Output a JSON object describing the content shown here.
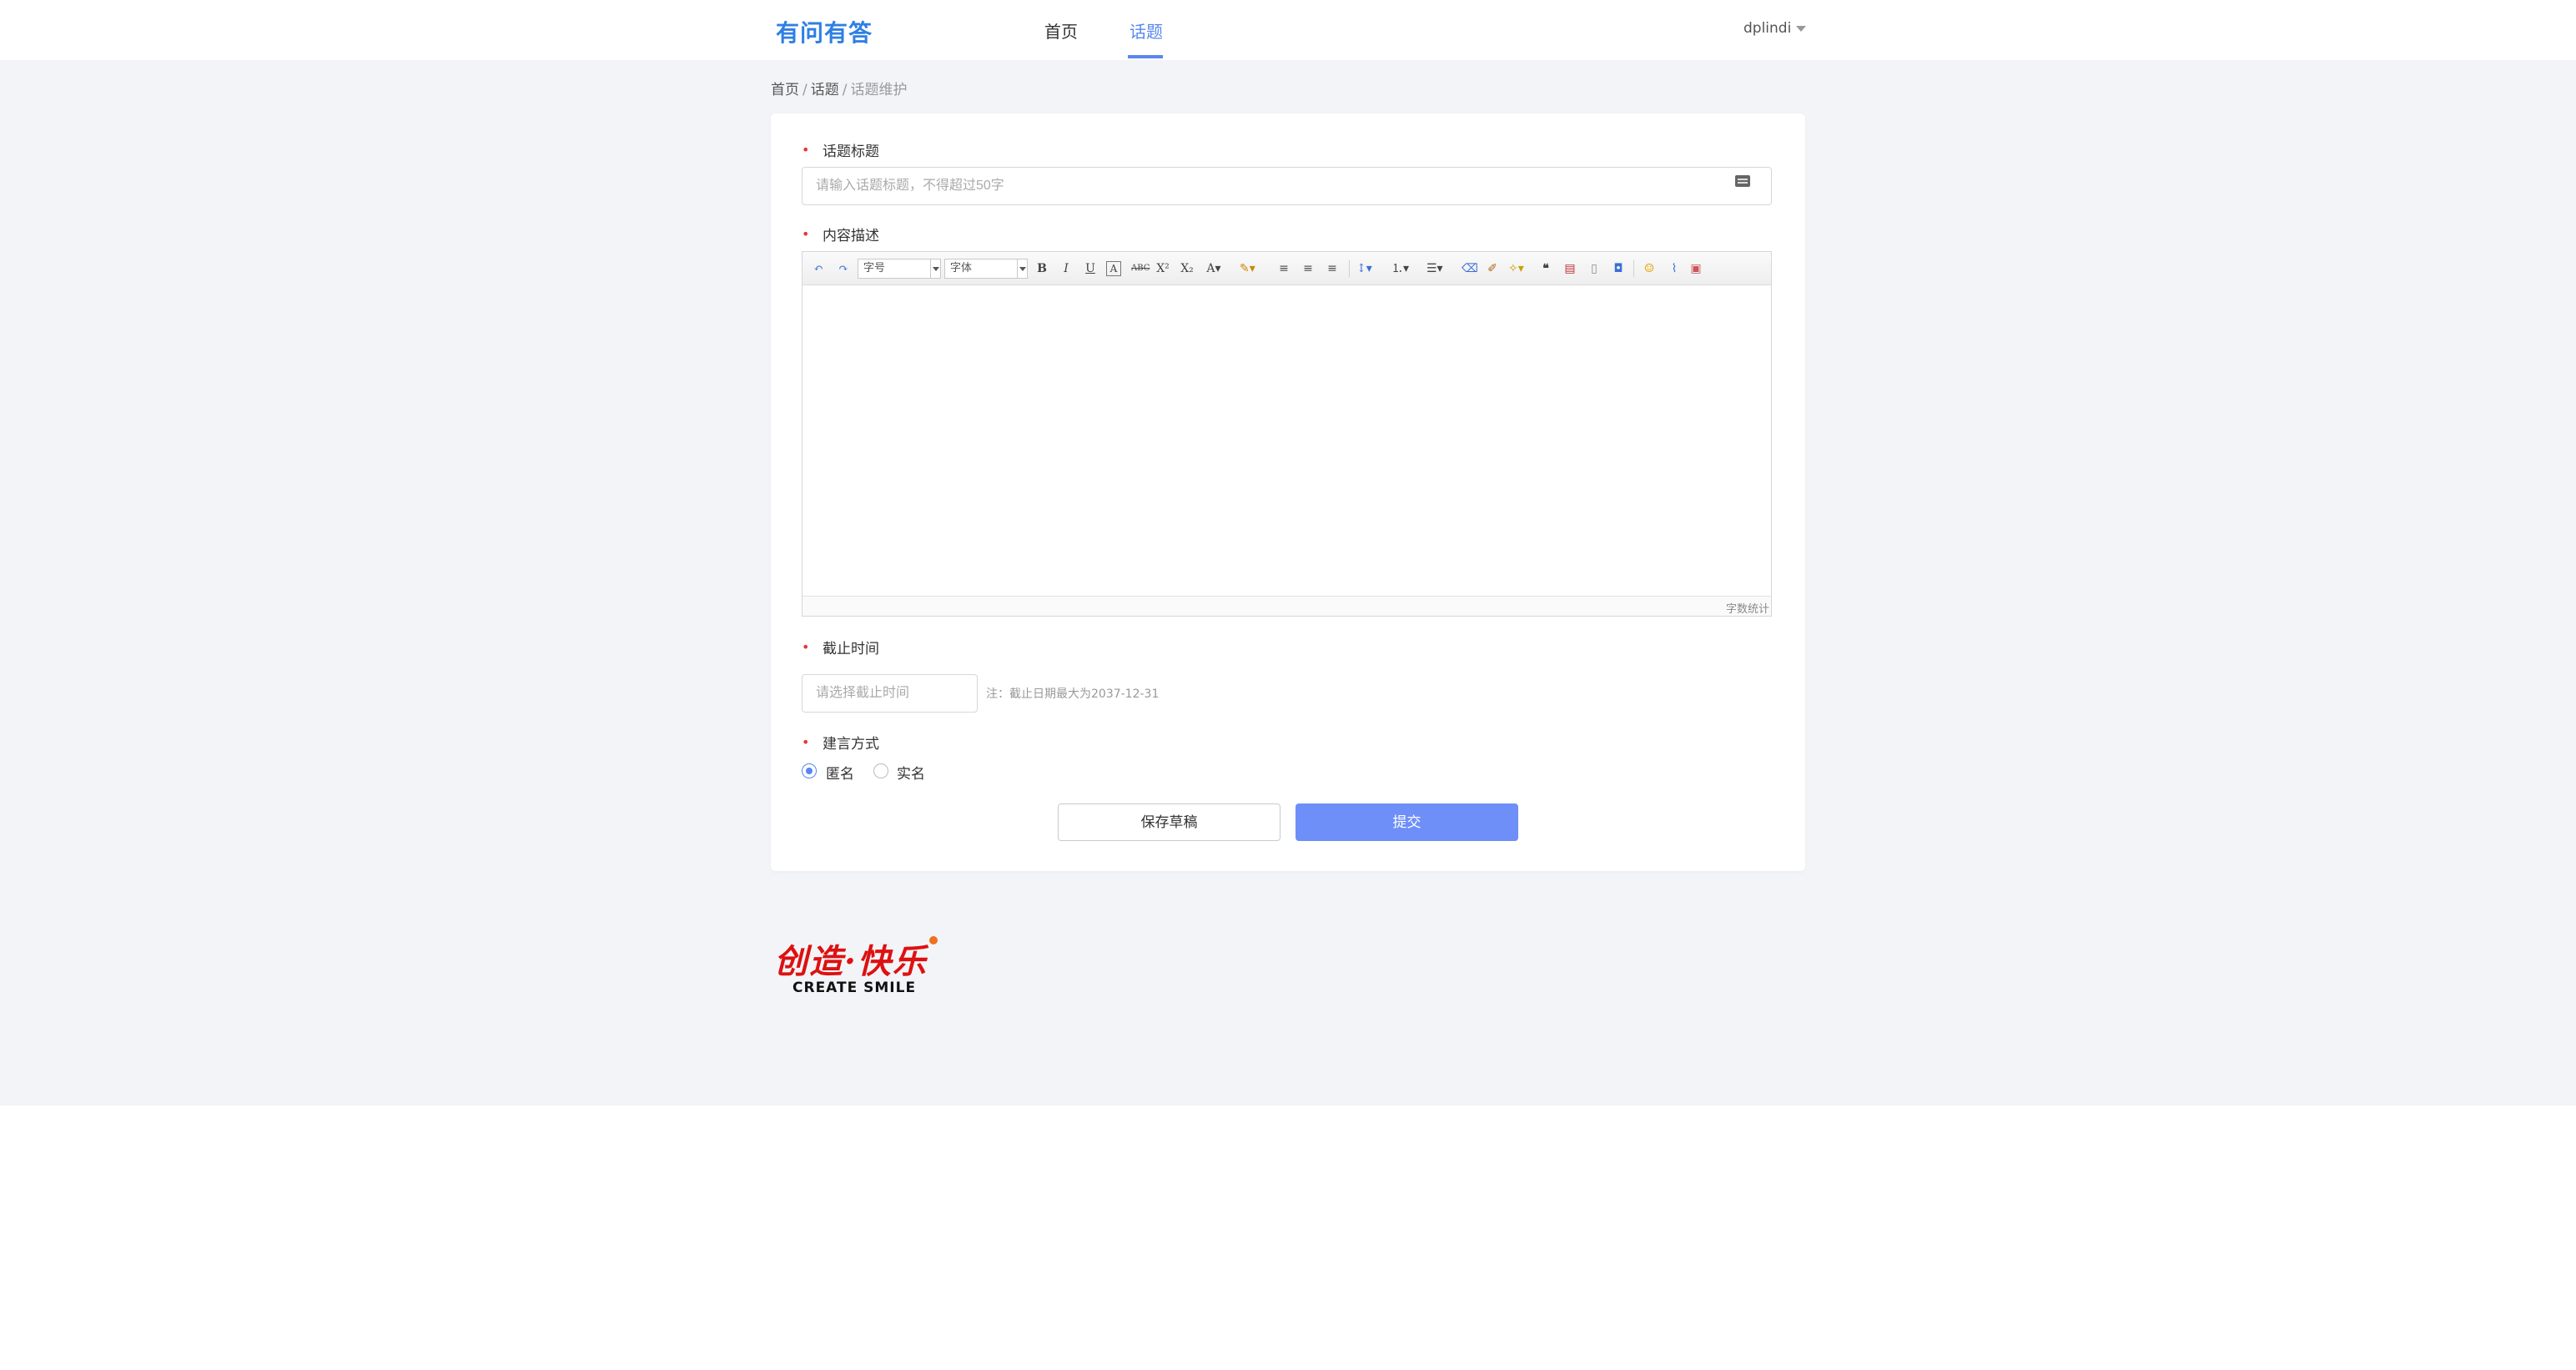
{
  "header": {
    "logo": "有问有答",
    "nav": [
      {
        "label": "首页",
        "active": false
      },
      {
        "label": "话题",
        "active": true
      }
    ],
    "user": "dplindi"
  },
  "breadcrumb": {
    "items": [
      "首页",
      "话题"
    ],
    "current": "话题维护"
  },
  "form": {
    "title_label": "话题标题",
    "title_placeholder": "请输入话题标题，不得超过50字",
    "content_label": "内容描述",
    "editor": {
      "font_size_select": "字号",
      "font_family_select": "字体",
      "word_count": "字数统计"
    },
    "deadline_label": "截止时间",
    "deadline_placeholder": "请选择截止时间",
    "deadline_note": "注：截止日期最大为2037-12-31",
    "speech_label": "建言方式",
    "options": [
      {
        "label": "匿名",
        "checked": true
      },
      {
        "label": "实名",
        "checked": false
      }
    ],
    "save_draft": "保存草稿",
    "submit": "提交"
  },
  "footer": {
    "slogan_cn": "创造·快乐",
    "slogan_en": "CREATE SMILE"
  },
  "colors": {
    "accent": "#5a86f0",
    "logo": "#2f7fe3",
    "required": "#e33333",
    "submit_bg": "#6e8ff8"
  }
}
